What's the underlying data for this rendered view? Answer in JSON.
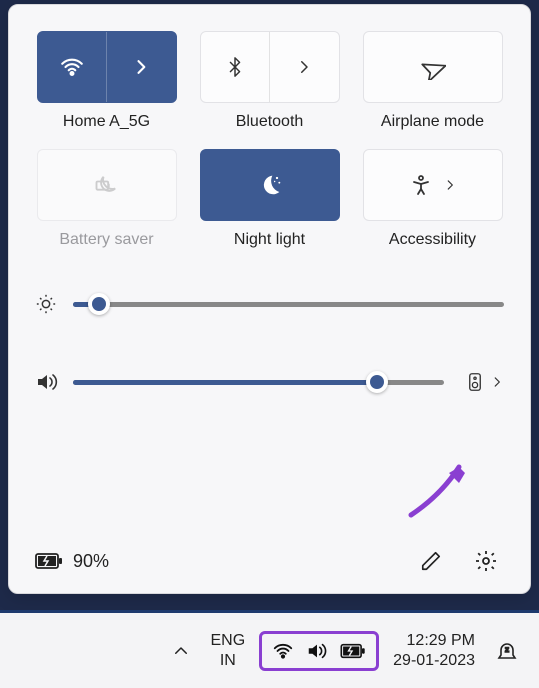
{
  "tiles": {
    "wifi": {
      "label": "Home A_5G",
      "active": true,
      "has_more": true
    },
    "bluetooth": {
      "label": "Bluetooth",
      "active": false,
      "has_more": true
    },
    "airplane": {
      "label": "Airplane mode",
      "active": false,
      "has_more": false
    },
    "battery_saver": {
      "label": "Battery saver",
      "active": false,
      "disabled": true,
      "has_more": false
    },
    "night_light": {
      "label": "Night light",
      "active": true,
      "has_more": false
    },
    "accessibility": {
      "label": "Accessibility",
      "active": false,
      "has_more": true
    }
  },
  "sliders": {
    "brightness": {
      "value_pct": 6
    },
    "volume": {
      "value_pct": 82
    }
  },
  "battery": {
    "percent_text": "90%"
  },
  "taskbar": {
    "lang_top": "ENG",
    "lang_bot": "IN",
    "time": "12:29 PM",
    "date": "29-01-2023"
  },
  "colors": {
    "accent": "#3d5a92",
    "annotation": "#8a3fd1"
  }
}
